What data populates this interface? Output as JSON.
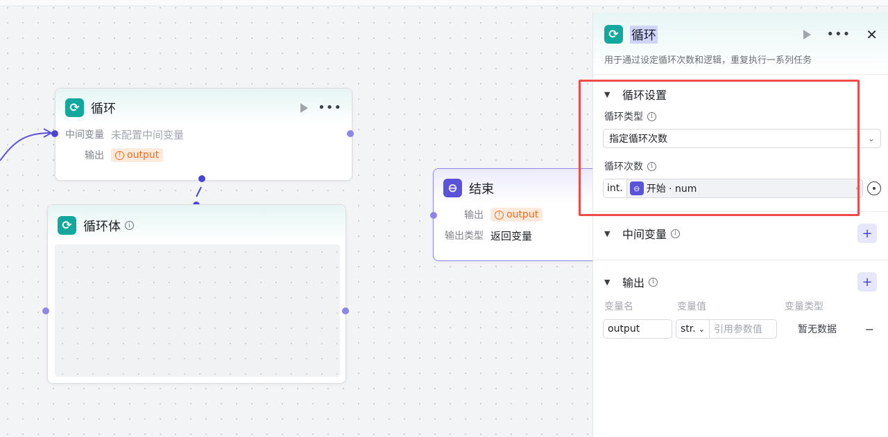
{
  "loop_node": {
    "title": "循环",
    "intermediate_label": "中间变量",
    "intermediate_value": "未配置中间变量",
    "output_label": "输出",
    "output_tag": "output",
    "icon": "loop-icon"
  },
  "loop_body_node": {
    "title": "循环体",
    "icon": "loop-icon"
  },
  "end_node": {
    "title": "结束",
    "output_label": "输出",
    "output_tag": "output",
    "output_type_label": "输出类型",
    "output_type_value": "返回变量",
    "icon": "end-icon"
  },
  "panel": {
    "title": "循环",
    "description": "用于通过设定循环次数和逻辑，重复执行一系列任务",
    "loop_settings": {
      "title": "循环设置",
      "loop_type_label": "循环类型",
      "loop_type_value": "指定循环次数",
      "loop_count_label": "循环次数",
      "loop_count_type": "int.",
      "loop_count_ref": "开始 · num"
    },
    "intermediate": {
      "title": "中间变量"
    },
    "output": {
      "title": "输出",
      "col_name": "变量名",
      "col_value": "变量值",
      "col_type": "变量类型",
      "row_name": "output",
      "row_value_type": "str.",
      "row_value_placeholder": "引用参数值",
      "row_type": "暂无数据"
    }
  },
  "colors": {
    "teal": "#12a89d",
    "violet": "#5a52d9",
    "port": "#8c86e8",
    "highlight": "#ef4b4b",
    "tag_orange": "#ed6d1c"
  }
}
